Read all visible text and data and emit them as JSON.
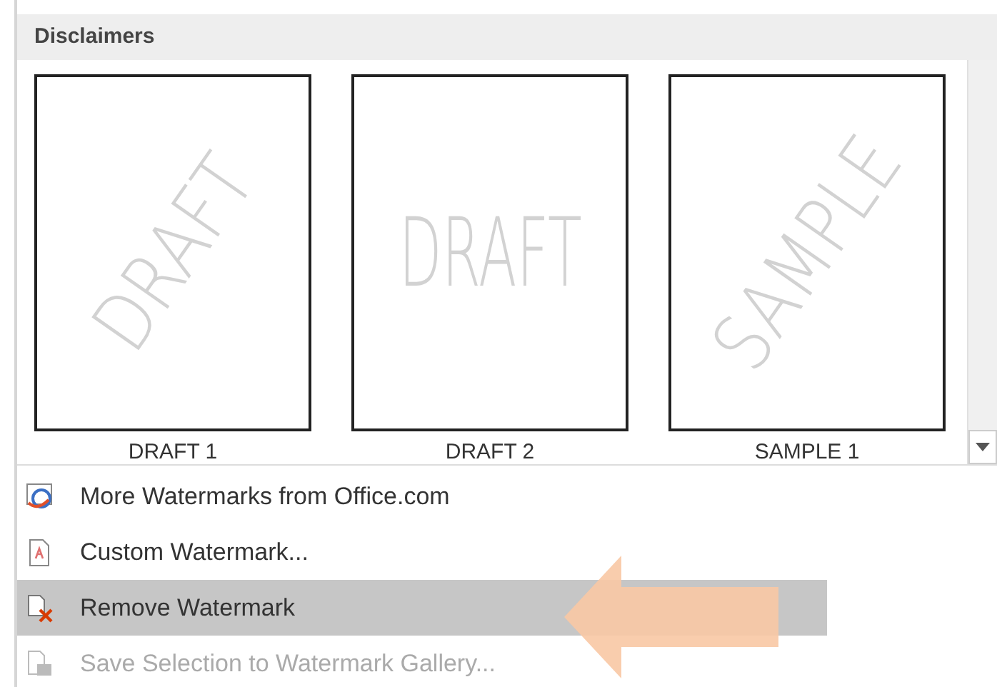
{
  "gallery": {
    "heading": "Disclaimers",
    "items": [
      {
        "label": "DRAFT 1",
        "preview_text": "DRAFT",
        "diagonal": true
      },
      {
        "label": "DRAFT 2",
        "preview_text": "DRAFT",
        "diagonal": false
      },
      {
        "label": "SAMPLE 1",
        "preview_text": "SAMPLE",
        "diagonal": true
      }
    ]
  },
  "menu": [
    {
      "kind": "online",
      "label": "More Watermarks from Office.com",
      "selected": false,
      "disabled": false
    },
    {
      "kind": "custom",
      "label": "Custom Watermark...",
      "selected": false,
      "disabled": false
    },
    {
      "kind": "remove",
      "label": "Remove Watermark",
      "selected": true,
      "disabled": false
    },
    {
      "kind": "save",
      "label": "Save Selection to Watermark Gallery...",
      "selected": false,
      "disabled": true
    }
  ]
}
